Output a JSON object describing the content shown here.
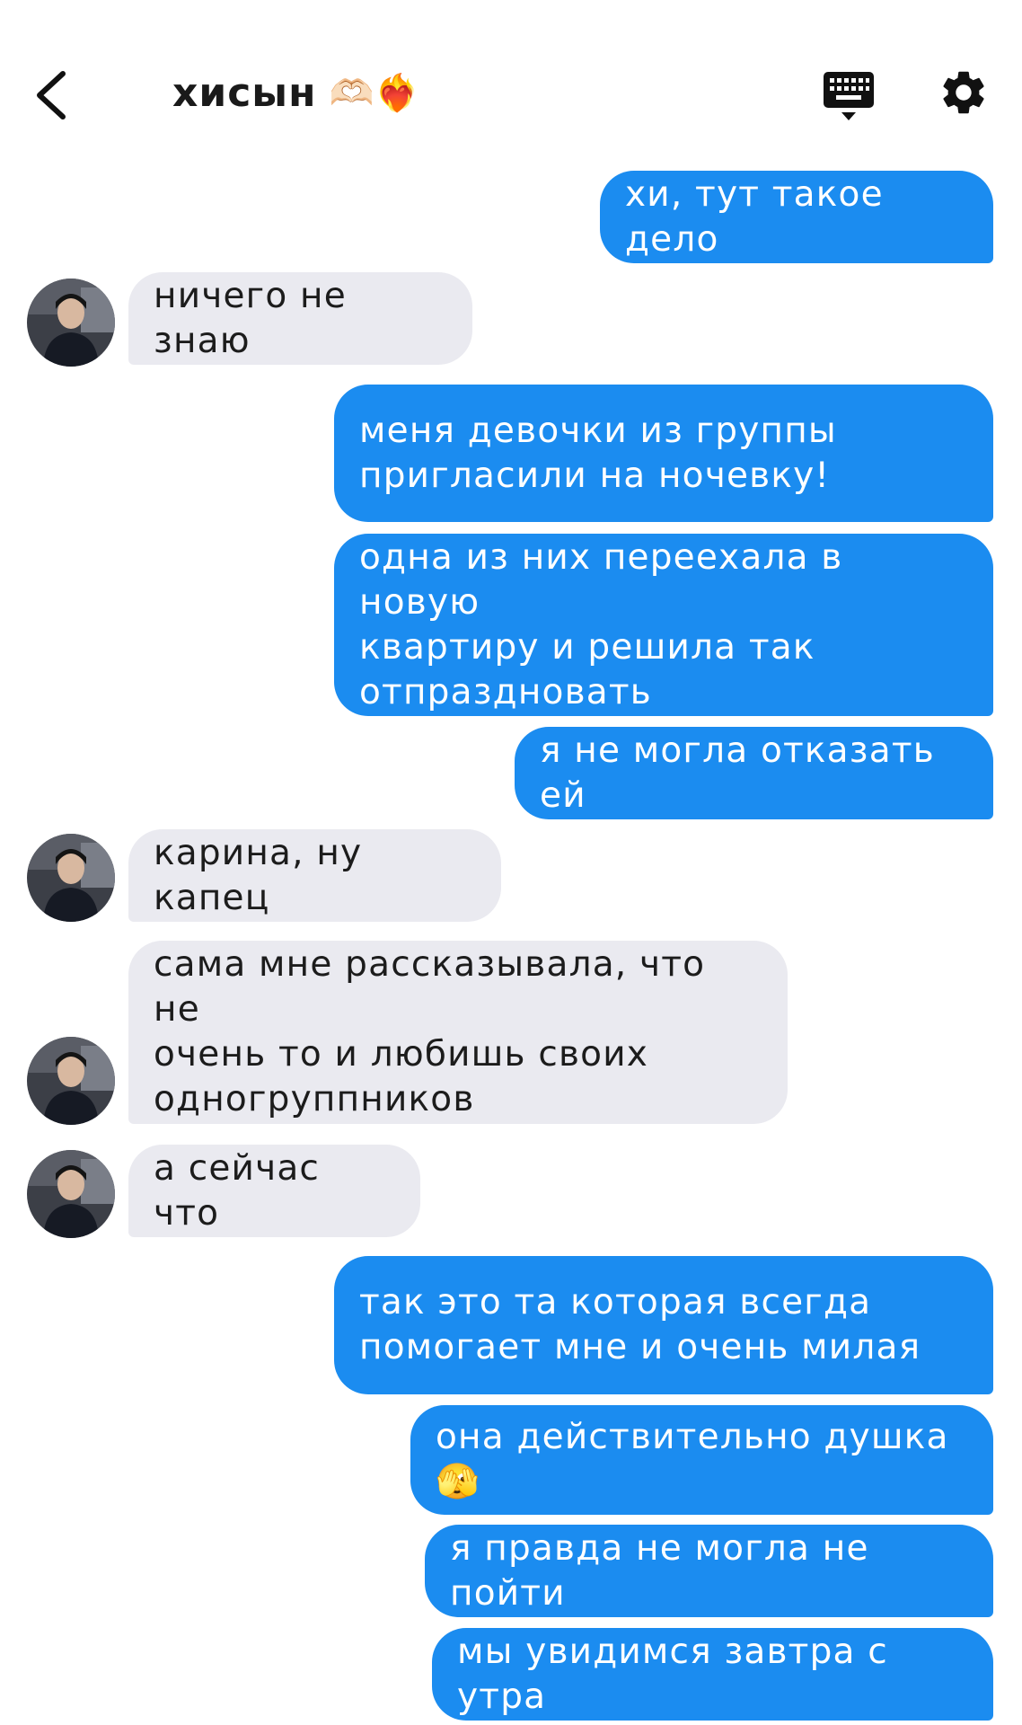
{
  "header": {
    "title": "хисын",
    "title_emojis": "🫶🏻❤️‍🔥"
  },
  "messages": [
    {
      "side": "out",
      "text": "хи, тут такое дело"
    },
    {
      "side": "in",
      "text": "ничего не знаю"
    },
    {
      "side": "out",
      "text": "меня девочки из группы\nпригласили на ночевку!"
    },
    {
      "side": "out",
      "text": "одна из них переехала в новую\nквартиру и решила так\nотпраздновать"
    },
    {
      "side": "out",
      "text": "я не могла отказать ей"
    },
    {
      "side": "in",
      "text": "карина, ну капец"
    },
    {
      "side": "in",
      "text": "сама мне рассказывала, что не\nочень то и любишь своих\nодногруппников"
    },
    {
      "side": "in",
      "text": "а сейчас что"
    },
    {
      "side": "out",
      "text": "так это та которая всегда\nпомогает мне и очень милая"
    },
    {
      "side": "out",
      "text": "она действительно душка 🫣"
    },
    {
      "side": "out",
      "text": "я правда не могла не пойти"
    },
    {
      "side": "out",
      "text": "мы увидимся завтра с утра"
    }
  ],
  "icons": {
    "back": "chevron-left-icon",
    "keyboard": "keyboard-icon",
    "settings": "gear-icon",
    "avatar": "avatar"
  },
  "colors": {
    "outgoing_bubble": "#1b8cf0",
    "incoming_bubble": "#eaeaf0",
    "icon_color": "#111111"
  }
}
